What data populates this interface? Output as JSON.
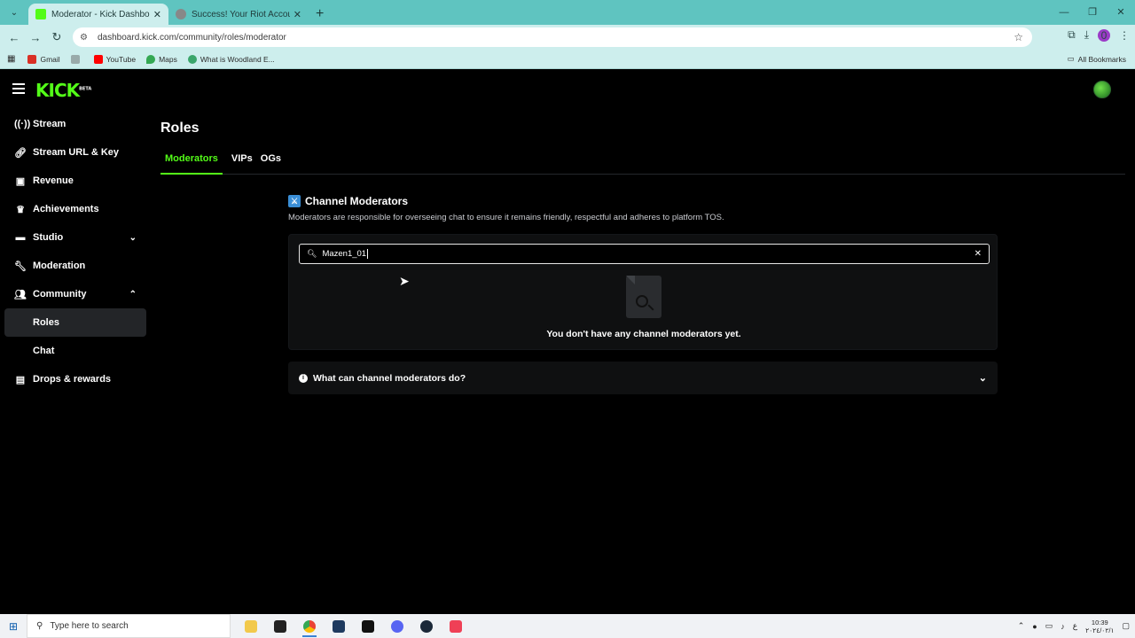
{
  "browser": {
    "tabs": [
      {
        "title": "Moderator - Kick Dashboard",
        "active": true,
        "favicon_color": "#53fc18"
      },
      {
        "title": "Success! Your Riot Account is n",
        "active": false,
        "favicon_color": "#888888"
      }
    ],
    "new_tab": "+",
    "url": "dashboard.kick.com/community/roles/moderator",
    "profile_initial": "0",
    "bookmarks": [
      {
        "label": "Gmail",
        "color": "#d93025"
      },
      {
        "label": "YouTube",
        "color": "#ff0000"
      },
      {
        "label": "Maps",
        "color": "#34a853"
      },
      {
        "label": "What is Woodland E...",
        "color": "#3aa66b"
      }
    ],
    "all_bookmarks": "All Bookmarks"
  },
  "app": {
    "logo": "KICK",
    "logo_sup": "BETA",
    "accent": "#53fc18",
    "sidebar": [
      {
        "label": "Stream",
        "icon": "broadcast-icon"
      },
      {
        "label": "Stream URL & Key",
        "icon": "link-icon"
      },
      {
        "label": "Revenue",
        "icon": "revenue-icon"
      },
      {
        "label": "Achievements",
        "icon": "trophy-icon"
      },
      {
        "label": "Studio",
        "icon": "studio-icon",
        "expandable": true
      },
      {
        "label": "Moderation",
        "icon": "wrench-icon"
      },
      {
        "label": "Community",
        "icon": "community-icon",
        "expandable": true,
        "expanded": true
      },
      {
        "label": "Roles",
        "sub": true,
        "active": true
      },
      {
        "label": "Chat",
        "sub": true
      },
      {
        "label": "Drops & rewards",
        "icon": "gift-icon"
      }
    ],
    "page_title": "Roles",
    "tabs": [
      "Moderators",
      "VIPs",
      "OGs"
    ],
    "section": {
      "title": "Channel Moderators",
      "description": "Moderators are responsible for overseeing chat to ensure it remains friendly, respectful and adheres to platform TOS.",
      "search_value": "Mazen1_01",
      "empty_text": "You don't have any channel moderators yet.",
      "faq": "What can channel moderators do?"
    }
  },
  "taskbar": {
    "search_placeholder": "Type here to search",
    "time": "10:39",
    "date": "٢٠٢٤/٠٢/١"
  }
}
